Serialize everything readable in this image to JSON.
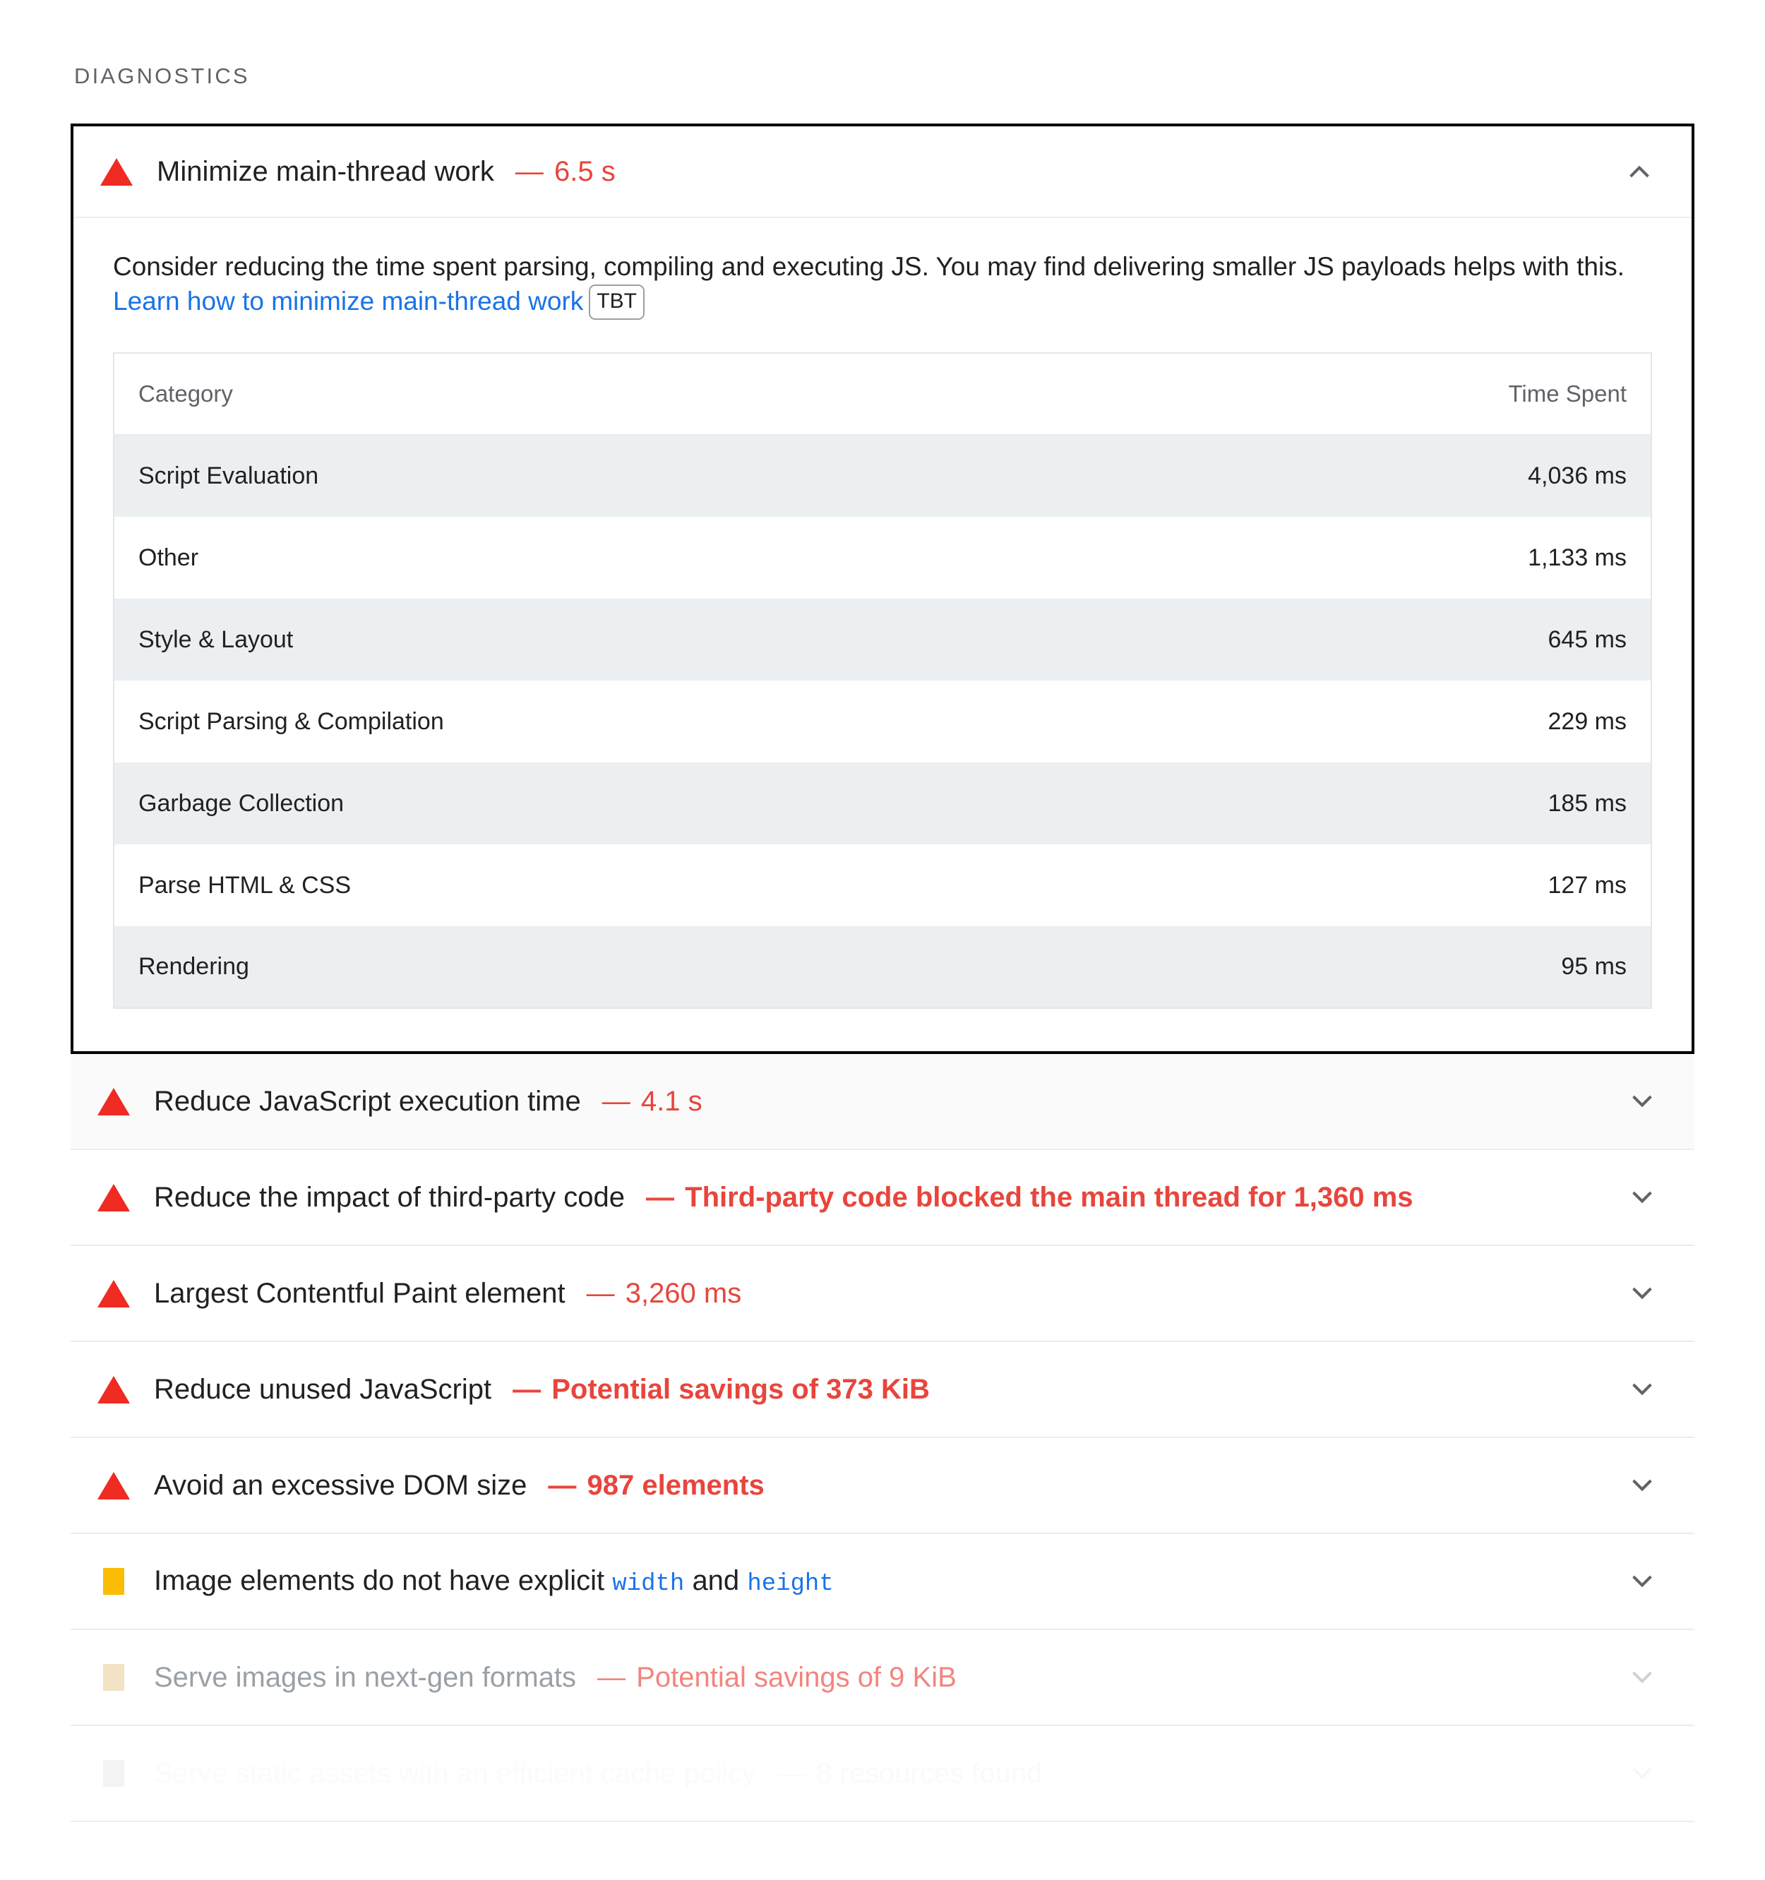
{
  "section": {
    "title": "DIAGNOSTICS"
  },
  "expanded_audit": {
    "severity_icon": "warning-triangle-icon",
    "title": "Minimize main-thread work",
    "dash": "—",
    "value": "6.5 s",
    "toggle_icon": "chevron-up-icon",
    "description_before": "Consider reducing the time spent parsing, compiling and executing JS. You may find delivering smaller JS payloads helps with this.",
    "link_text": "Learn how to minimize main-thread work",
    "badge": "TBT",
    "table": {
      "columns": [
        "Category",
        "Time Spent"
      ],
      "rows": [
        {
          "category": "Script Evaluation",
          "time": "4,036 ms"
        },
        {
          "category": "Other",
          "time": "1,133 ms"
        },
        {
          "category": "Style & Layout",
          "time": "645 ms"
        },
        {
          "category": "Script Parsing & Compilation",
          "time": "229 ms"
        },
        {
          "category": "Garbage Collection",
          "time": "185 ms"
        },
        {
          "category": "Parse HTML & CSS",
          "time": "127 ms"
        },
        {
          "category": "Rendering",
          "time": "95 ms"
        }
      ]
    }
  },
  "collapsed_audits": [
    {
      "icon": "warning-triangle-icon",
      "title": "Reduce JavaScript execution time",
      "dash": "—",
      "value": "4.1 s",
      "toggle_icon": "chevron-down-icon"
    },
    {
      "icon": "warning-triangle-icon",
      "title": "Reduce the impact of third-party code",
      "dash": "—",
      "value": "Third-party code blocked the main thread for 1,360 ms",
      "toggle_icon": "chevron-down-icon"
    },
    {
      "icon": "warning-triangle-icon",
      "title": "Largest Contentful Paint element",
      "dash": "—",
      "value": "3,260 ms",
      "toggle_icon": "chevron-down-icon"
    },
    {
      "icon": "warning-triangle-icon",
      "title": "Reduce unused JavaScript",
      "dash": "—",
      "value": "Potential savings of 373 KiB",
      "toggle_icon": "chevron-down-icon"
    },
    {
      "icon": "warning-triangle-icon",
      "title": "Avoid an excessive DOM size",
      "dash": "—",
      "value": "987 elements",
      "toggle_icon": "chevron-down-icon"
    },
    {
      "icon": "warning-square-icon",
      "title_part1": "Image elements do not have explicit",
      "code1": "width",
      "title_part2": "and",
      "code2": "height",
      "toggle_icon": "chevron-down-icon"
    },
    {
      "icon": "warning-square-icon",
      "title": "Serve images in next-gen formats",
      "dash": "—",
      "value": "Potential savings of 9 KiB",
      "toggle_icon": "chevron-down-icon"
    },
    {
      "icon": "warning-square-icon",
      "title": "Serve static assets with an efficient cache policy",
      "dash": "—",
      "value": "8 resources found",
      "toggle_icon": "chevron-down-icon"
    }
  ],
  "colors": {
    "fail_red": "#e8453c",
    "triangle_red": "#f22",
    "warn_orange": "#fbbc05",
    "link_blue": "#1a73e8",
    "shade_row": "#eceff1"
  }
}
